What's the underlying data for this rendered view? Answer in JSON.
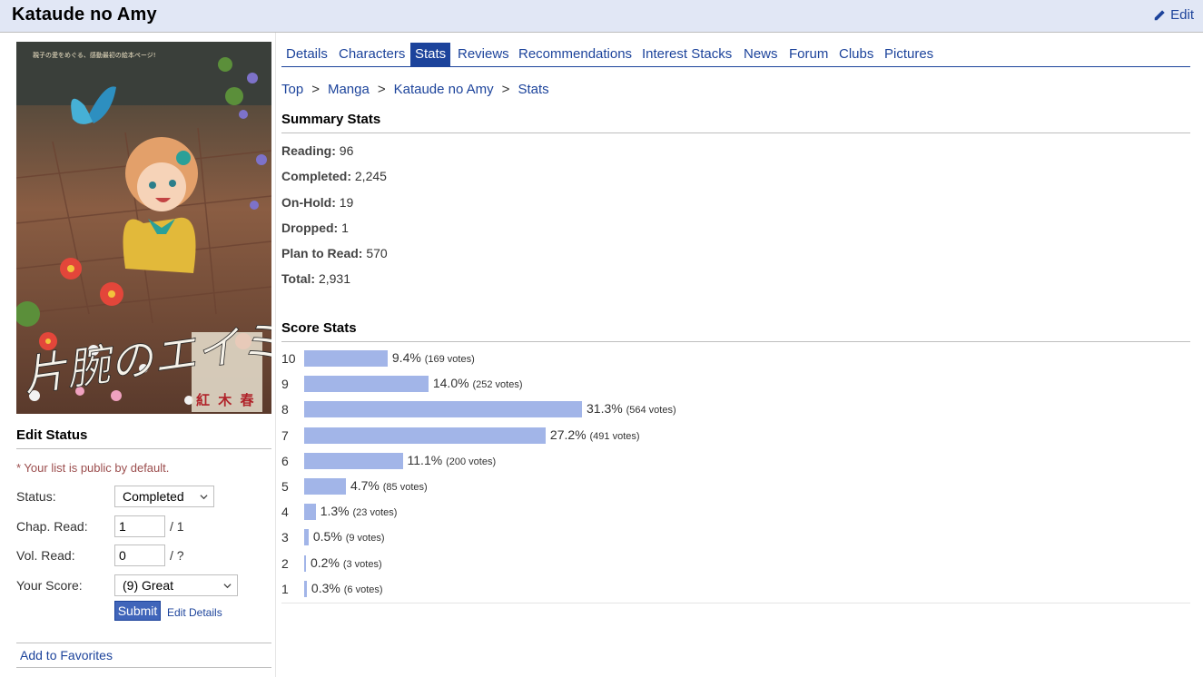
{
  "header": {
    "title": "Kataude no Amy",
    "edit_label": "Edit"
  },
  "cover": {
    "title_art": "片腕のエイミー",
    "author_art": "紅 木 春",
    "tagline_art": "親子の愛をめぐる、感動最初の絵本ページ!"
  },
  "sidebar": {
    "edit_status_title": "Edit Status",
    "public_note": "* Your list is public by default.",
    "status_label": "Status:",
    "status_value": "Completed",
    "chap_label": "Chap. Read:",
    "chap_value": "1",
    "chap_total": "/ 1",
    "vol_label": "Vol. Read:",
    "vol_value": "0",
    "vol_total": "/ ?",
    "score_label": "Your Score:",
    "score_value": "(9) Great",
    "submit_label": "Submit",
    "edit_details_label": "Edit Details",
    "add_favorites_label": "Add to Favorites"
  },
  "tabs": [
    "Details",
    "Characters",
    "Stats",
    "Reviews",
    "Recommendations",
    "Interest Stacks",
    "News",
    "Forum",
    "Clubs",
    "Pictures"
  ],
  "active_tab": "Stats",
  "breadcrumb": [
    "Top",
    "Manga",
    "Kataude no Amy",
    "Stats"
  ],
  "summary": {
    "title": "Summary Stats",
    "rows": [
      {
        "label": "Reading:",
        "value": "96"
      },
      {
        "label": "Completed:",
        "value": "2,245"
      },
      {
        "label": "On-Hold:",
        "value": "19"
      },
      {
        "label": "Dropped:",
        "value": "1"
      },
      {
        "label": "Plan to Read:",
        "value": "570"
      },
      {
        "label": "Total:",
        "value": "2,931"
      }
    ]
  },
  "score_stats": {
    "title": "Score Stats",
    "bar_color": "#a2b5e8",
    "rows": [
      {
        "score": "10",
        "pct": 9.4,
        "pct_text": "9.4%",
        "votes_text": "(169 votes)"
      },
      {
        "score": "9",
        "pct": 14.0,
        "pct_text": "14.0%",
        "votes_text": "(252 votes)"
      },
      {
        "score": "8",
        "pct": 31.3,
        "pct_text": "31.3%",
        "votes_text": "(564 votes)"
      },
      {
        "score": "7",
        "pct": 27.2,
        "pct_text": "27.2%",
        "votes_text": "(491 votes)"
      },
      {
        "score": "6",
        "pct": 11.1,
        "pct_text": "11.1%",
        "votes_text": "(200 votes)"
      },
      {
        "score": "5",
        "pct": 4.7,
        "pct_text": "4.7%",
        "votes_text": "(85 votes)"
      },
      {
        "score": "4",
        "pct": 1.3,
        "pct_text": "1.3%",
        "votes_text": "(23 votes)"
      },
      {
        "score": "3",
        "pct": 0.5,
        "pct_text": "0.5%",
        "votes_text": "(9 votes)"
      },
      {
        "score": "2",
        "pct": 0.2,
        "pct_text": "0.2%",
        "votes_text": "(3 votes)"
      },
      {
        "score": "1",
        "pct": 0.3,
        "pct_text": "0.3%",
        "votes_text": "(6 votes)"
      }
    ]
  }
}
